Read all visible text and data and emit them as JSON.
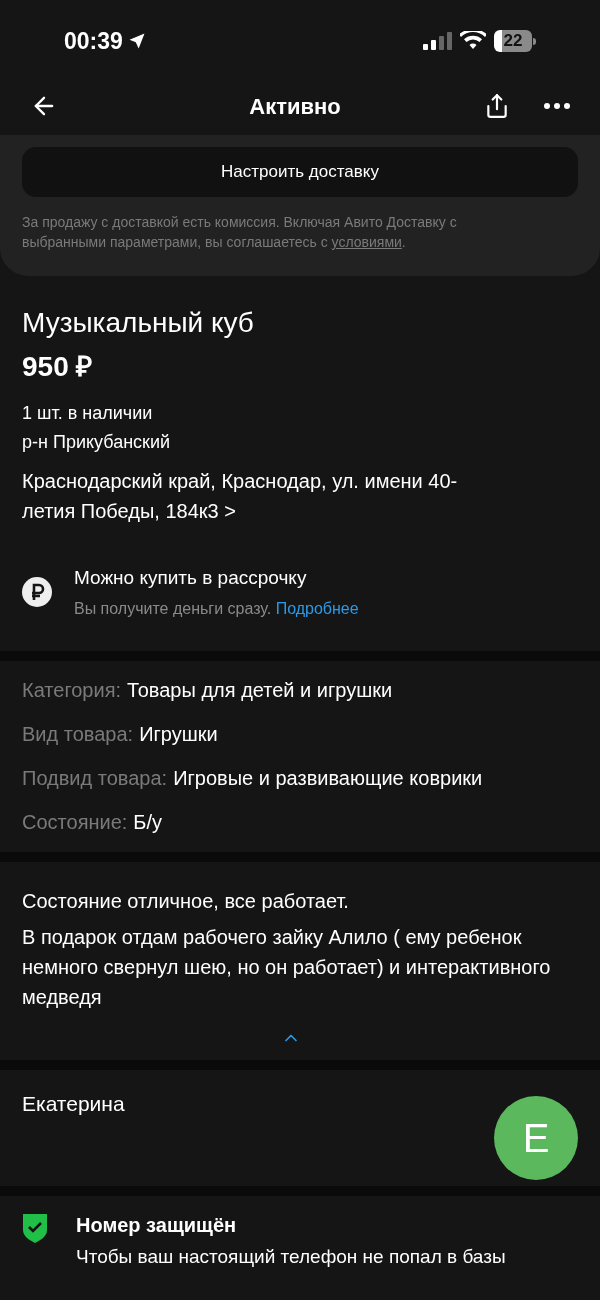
{
  "status_bar": {
    "time": "00:39",
    "battery": "22"
  },
  "nav": {
    "title": "Активно"
  },
  "delivery": {
    "button": "Настроить доставку",
    "note": "За продажу с доставкой есть комиссия. Включая Авито Доставку с выбранными параметрами, вы соглашаетесь с ",
    "link": "условиями",
    "note_end": "."
  },
  "item": {
    "title": "Музыкальный куб",
    "price": "950 ₽",
    "stock": "1 шт. в наличии",
    "district": "р-н Прикубанский",
    "address": "Краснодарский край, Краснодар, ул. имени 40-летия Победы, 184к3",
    "address_arrow": ">"
  },
  "installment": {
    "title": "Можно купить в рассрочку",
    "text": "Вы получите деньги сразу.",
    "link": "Подробнее"
  },
  "params": [
    {
      "label": "Категория:",
      "value": "Товары для детей и игрушки"
    },
    {
      "label": "Вид товара:",
      "value": "Игрушки"
    },
    {
      "label": "Подвид товара:",
      "value": "Игровые и развивающие коврики"
    },
    {
      "label": "Состояние:",
      "value": "Б/у"
    }
  ],
  "description": {
    "paragraphs": [
      "Состояние отличное, все работает.",
      "В подарок отдам рабочего зайку Алило ( ему ребенок немного свернул шею, но он работает) и интерактивного медведя"
    ],
    "expanded": true
  },
  "seller": {
    "name": "Екатерина",
    "avatar_letter": "Е",
    "color": "#5cb85c"
  },
  "security": {
    "title": "Номер защищён",
    "text": "Чтобы ваш настоящий телефон не попал в базы"
  }
}
